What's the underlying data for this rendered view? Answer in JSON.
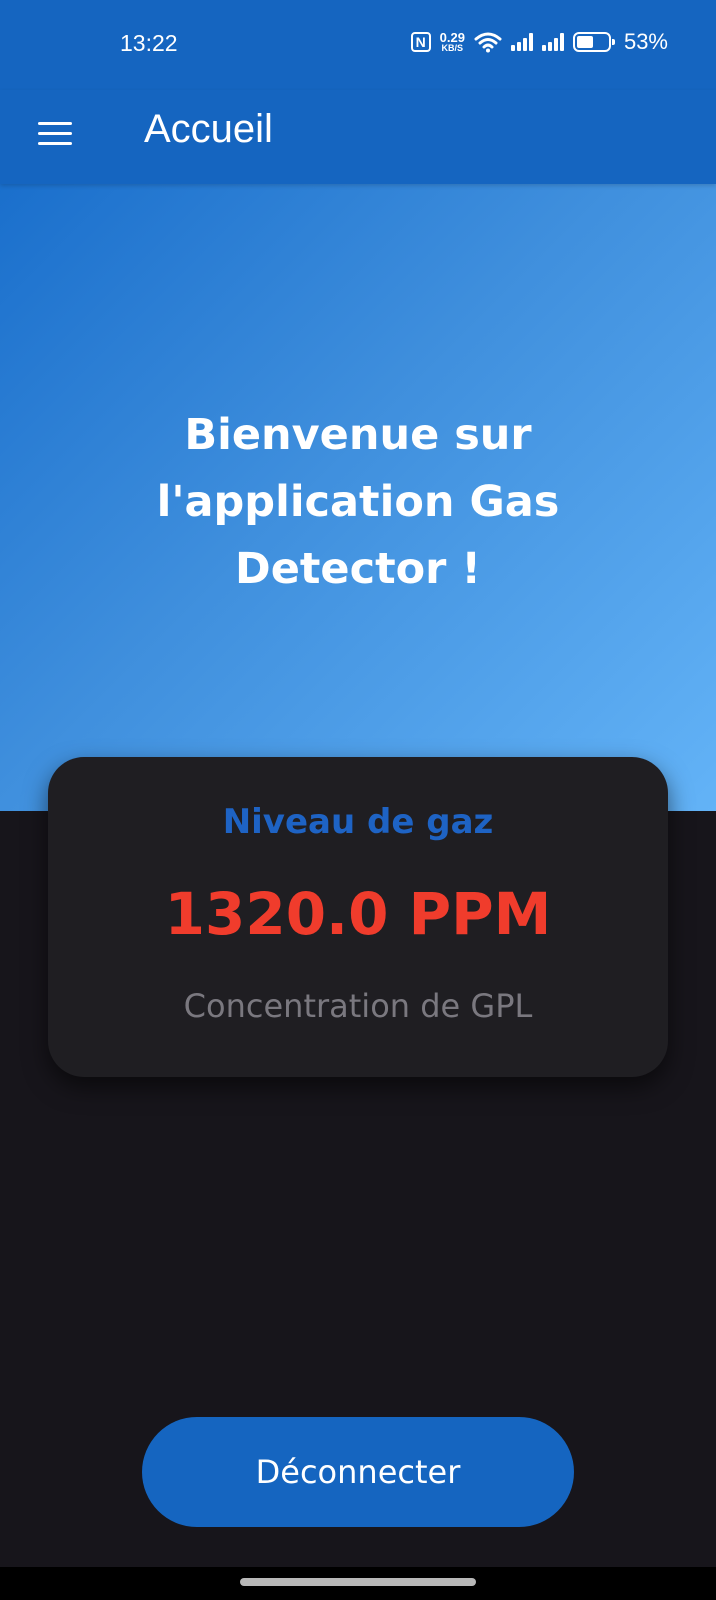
{
  "status_bar": {
    "time": "13:22",
    "nfc_icon": "nfc-icon",
    "net_speed_value": "0.29",
    "net_speed_unit": "KB/S",
    "wifi_icon": "wifi-icon",
    "signal_icons": [
      "signal-sim1-icon",
      "signal-sim2-icon"
    ],
    "battery_icon": "battery-icon",
    "battery_level": 0.53,
    "battery_text": "53%"
  },
  "app_bar": {
    "menu_icon": "menu-icon",
    "title": "Accueil"
  },
  "hero": {
    "welcome_text": "Bienvenue sur l'application Gas Detector !"
  },
  "gas_card": {
    "title": "Niveau de gaz",
    "value": "1320.0 PPM",
    "caption": "Concentration de GPL"
  },
  "actions": {
    "logout_label": "Déconnecter"
  },
  "colors": {
    "primary": "#1565c0",
    "background": "#17151b",
    "card": "#1f1e22",
    "gas_value": "#f03c2c",
    "card_title": "#1e63c4",
    "caption": "#7a787f"
  }
}
